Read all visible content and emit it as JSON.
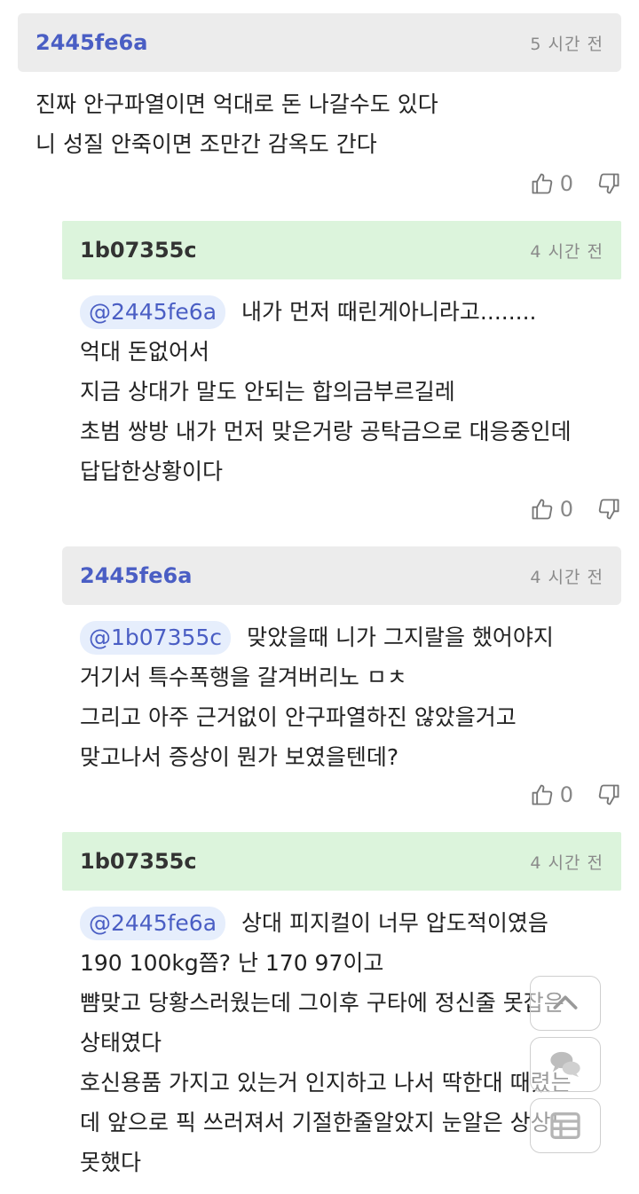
{
  "comments": [
    {
      "author": "2445fe6a",
      "time": "5 시간 전",
      "mention": "",
      "lines": [
        "진짜 안구파열이면 억대로 돈 나갈수도 있다",
        "니 성질 안죽이면 조만간 감옥도 간다"
      ],
      "likes": "0"
    },
    {
      "author": "1b07355c",
      "time": "4 시간 전",
      "mention": "@2445fe6a",
      "lines": [
        "내가 먼저 때린게아니라고........",
        "억대 돈없어서",
        "지금 상대가 말도 안되는 합의금부르길레",
        "초범 쌍방 내가 먼저 맞은거랑 공탁금으로 대응중인데",
        "답답한상황이다"
      ],
      "likes": "0"
    },
    {
      "author": "2445fe6a",
      "time": "4 시간 전",
      "mention": "@1b07355c",
      "lines": [
        "맞았을때 니가 그지랄을 했어야지",
        "거기서 특수폭행을 갈겨버리노 ㅁㅊ",
        "그리고 아주 근거없이 안구파열하진 않았을거고",
        "맞고나서 증상이 뭔가 보였을텐데?"
      ],
      "likes": "0"
    },
    {
      "author": "1b07355c",
      "time": "4 시간 전",
      "mention": "@2445fe6a",
      "lines": [
        "상대 피지컬이 너무 압도적이였음",
        "190 100kg쯤? 난 170 97이고",
        "뺨맞고 당황스러웠는데 그이후 구타에 정신줄 못잡은",
        "상태였다",
        "호신용품 가지고 있는거 인지하고 나서 딱한대 때렸는",
        "데 앞으로 픽 쓰러져서 기절한줄알았지 눈알은 상상도",
        "못했다"
      ]
    }
  ],
  "icons": {
    "like": "thumbs-up-icon",
    "dislike": "thumbs-down-icon",
    "scroll_top": "chevron-up-icon",
    "chat": "chat-bubbles-icon",
    "list": "list-icon"
  },
  "colors": {
    "author_blue": "#4a5ec4",
    "header_gray": "#ececec",
    "header_green": "#dcf4dc",
    "mention_bg": "#e6eefc"
  }
}
